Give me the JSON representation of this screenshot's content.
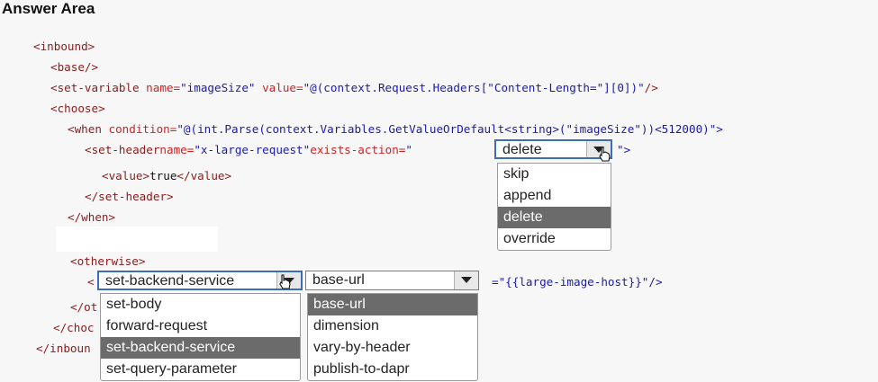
{
  "title": "Answer Area",
  "code": {
    "inbound_open": "<inbound>",
    "base": "<base/>",
    "set_variable": {
      "open": "<set-variable ",
      "name_attr": "name=",
      "name_val": "\"imageSize\"",
      "value_attr": " value=",
      "value_val": "\"@(context.Request.Headers[\"Content-Length=\"][0])\"",
      "close": "/>"
    },
    "choose_open": "<choose>",
    "when": {
      "open": "<when ",
      "cond_attr": "condition=",
      "cond_val": "\"@(int.Parse(context.Variables.GetValueOrDefault<string>(\"imageSize\"))<512000)\">"
    },
    "set_header": {
      "open": "<set-header",
      "name_attr": "name=",
      "name_val": "\"x-large-request\"",
      "exists_attr": "exists-action=",
      "quote_open": "\"",
      "quote_close": "\">"
    },
    "value_line": {
      "open": "<value>",
      "text": "true",
      "close": "</value>"
    },
    "set_header_close": "</set-header>",
    "when_close": "</when>",
    "otherwise_open": "<otherwise>",
    "lt": "<",
    "policy_tail": "=\"{{large-image-host}}\"/>",
    "otherwise_close_partial": "</ot",
    "choose_close_partial": "</choc",
    "inbound_close_partial": "</inboun"
  },
  "exists_action_dropdown": {
    "selected": "delete",
    "options": [
      "skip",
      "append",
      "delete",
      "override"
    ],
    "highlighted_index": 2
  },
  "policy_dropdown": {
    "selected": "set-backend-service",
    "options": [
      "set-body",
      "forward-request",
      "set-backend-service",
      "set-query-parameter"
    ],
    "highlighted_index": 2
  },
  "attribute_dropdown": {
    "selected": "base-url",
    "options": [
      "base-url",
      "dimension",
      "vary-by-header",
      "publish-to-dapr"
    ],
    "highlighted_index": 0
  }
}
